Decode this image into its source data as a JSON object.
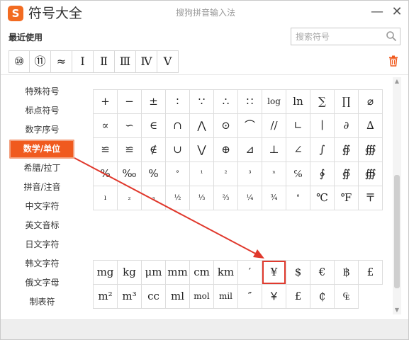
{
  "window": {
    "title": "符号大全",
    "ime_name": "搜狗拼音输入法",
    "logo_letter": "S",
    "minimize": "—",
    "close": "✕"
  },
  "recent": {
    "label": "最近使用",
    "items": [
      "⑩",
      "⑪",
      "≈",
      "Ⅰ",
      "Ⅱ",
      "Ⅲ",
      "Ⅳ",
      "Ⅴ"
    ]
  },
  "search": {
    "placeholder": "搜索符号"
  },
  "icons": {
    "search": "search-icon",
    "trash": "trash-icon",
    "accent": "#f05a1e",
    "highlight": "#e03a2e",
    "arrow": "#e0382c"
  },
  "sidebar": {
    "items": [
      {
        "label": "特殊符号"
      },
      {
        "label": "标点符号"
      },
      {
        "label": "数字序号"
      },
      {
        "label": "数学/单位",
        "active": true
      },
      {
        "label": "希腊/拉丁"
      },
      {
        "label": "拼音/注音"
      },
      {
        "label": "中文字符"
      },
      {
        "label": "英文音标"
      },
      {
        "label": "日文字符"
      },
      {
        "label": "韩文字符"
      },
      {
        "label": "俄文字母"
      },
      {
        "label": "制表符"
      }
    ]
  },
  "math": {
    "rows": [
      [
        "+",
        "−",
        "±",
        "∶",
        "∵",
        "∴",
        "∷",
        "log",
        "ln",
        "∑",
        "∏",
        "⌀"
      ],
      [
        "∝",
        "∽",
        "∈",
        "∩",
        "⋀",
        "⊙",
        "⌒",
        "//",
        "∟",
        "∣",
        "∂",
        "∆"
      ],
      [
        "≌",
        "≌",
        "∉",
        "∪",
        "⋁",
        "⊕",
        "⊿",
        "⊥",
        "∠",
        "∫",
        "∯",
        "∰"
      ],
      [
        "%",
        "‰",
        "%",
        "°",
        "¹",
        "²",
        "³",
        "ⁿ",
        "℅",
        "∲",
        "∯",
        "∰"
      ],
      [
        "ı",
        "₂",
        "₃",
        "½",
        "⅓",
        "⅔",
        "¼",
        "¾",
        "°",
        "℃",
        "℉",
        "〒"
      ]
    ]
  },
  "units": {
    "rows": [
      [
        "mg",
        "kg",
        "μm",
        "mm",
        "cm",
        "km",
        "′",
        "¥",
        "$",
        "€",
        "฿",
        "£"
      ],
      [
        "m²",
        "m³",
        "cc",
        "ml",
        "mol",
        "mil",
        "″",
        "￥",
        "£",
        "₵",
        "₠"
      ]
    ]
  }
}
